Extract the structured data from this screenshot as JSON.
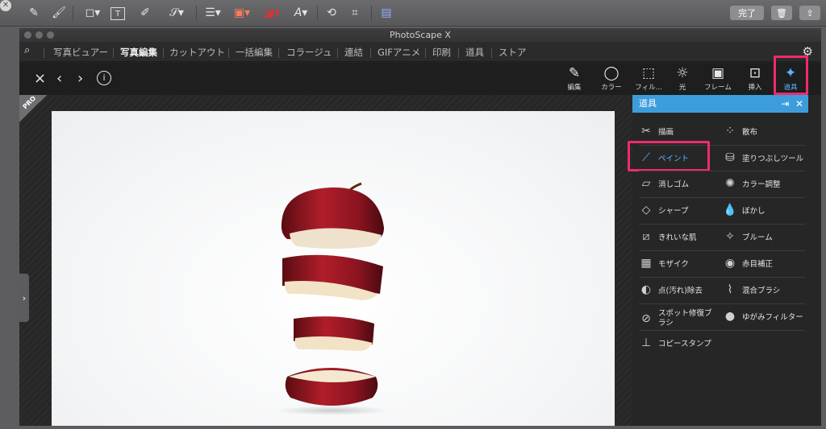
{
  "mac_toolbar": {
    "done_label": "完了",
    "icons": [
      "close-icon",
      "pen-icon",
      "brush-icon",
      "shape-icon",
      "text-icon",
      "highlighter-icon",
      "signature-icon",
      "line-style-icon",
      "border-color-icon",
      "fill-color-icon",
      "font-icon",
      "rotate-icon",
      "crop-icon",
      "description-icon",
      "trash-icon",
      "share-icon"
    ]
  },
  "window": {
    "title": "PhotoScape X"
  },
  "menu": {
    "items": [
      "写真ビュアー",
      "写真編集",
      "カットアウト",
      "一括編集",
      "コラージュ",
      "連結",
      "GIFアニメ",
      "印刷",
      "道具",
      "ストア"
    ],
    "active_index": 1
  },
  "tools": [
    {
      "label": "編集",
      "icon": "edit-icon"
    },
    {
      "label": "カラー",
      "icon": "color-icon"
    },
    {
      "label": "フィル...",
      "icon": "filter-icon"
    },
    {
      "label": "光",
      "icon": "light-icon"
    },
    {
      "label": "フレーム",
      "icon": "frame-icon"
    },
    {
      "label": "挿入",
      "icon": "insert-icon"
    },
    {
      "label": "道具",
      "icon": "tools-icon",
      "active": true
    }
  ],
  "nav": {
    "close": "×",
    "prev": "‹",
    "next": "›",
    "info": "i"
  },
  "pro_badge": "PRO",
  "panel": {
    "title": "道具",
    "items": [
      {
        "label": "描画",
        "icon": "draw-icon"
      },
      {
        "label": "散布",
        "icon": "scatter-icon"
      },
      {
        "label": "ペイント",
        "icon": "paint-brush-icon",
        "active": true
      },
      {
        "label": "塗りつぶしツール",
        "icon": "bucket-icon",
        "pro": true
      },
      {
        "label": "消しゴム",
        "icon": "eraser-icon"
      },
      {
        "label": "カラー調整",
        "icon": "color-adjust-icon"
      },
      {
        "label": "シャープ",
        "icon": "sharpen-icon"
      },
      {
        "label": "ぼかし",
        "icon": "blur-icon"
      },
      {
        "label": "きれいな肌",
        "icon": "skin-icon"
      },
      {
        "label": "ブルーム",
        "icon": "bloom-icon"
      },
      {
        "label": "モザイク",
        "icon": "mosaic-icon"
      },
      {
        "label": "赤目補正",
        "icon": "red-eye-icon"
      },
      {
        "label": "点(汚れ)除去",
        "icon": "spot-icon"
      },
      {
        "label": "混合ブラシ",
        "icon": "mix-brush-icon"
      },
      {
        "label": "スポット修復ブラシ",
        "icon": "healing-icon"
      },
      {
        "label": "ゆがみフィルター",
        "icon": "liquify-icon"
      },
      {
        "label": "コピースタンプ",
        "icon": "clone-stamp-icon",
        "pro": true
      }
    ]
  },
  "colors": {
    "accent": "#3d9ddc",
    "highlight": "#ef2b6c",
    "active_text": "#5db8ff"
  }
}
